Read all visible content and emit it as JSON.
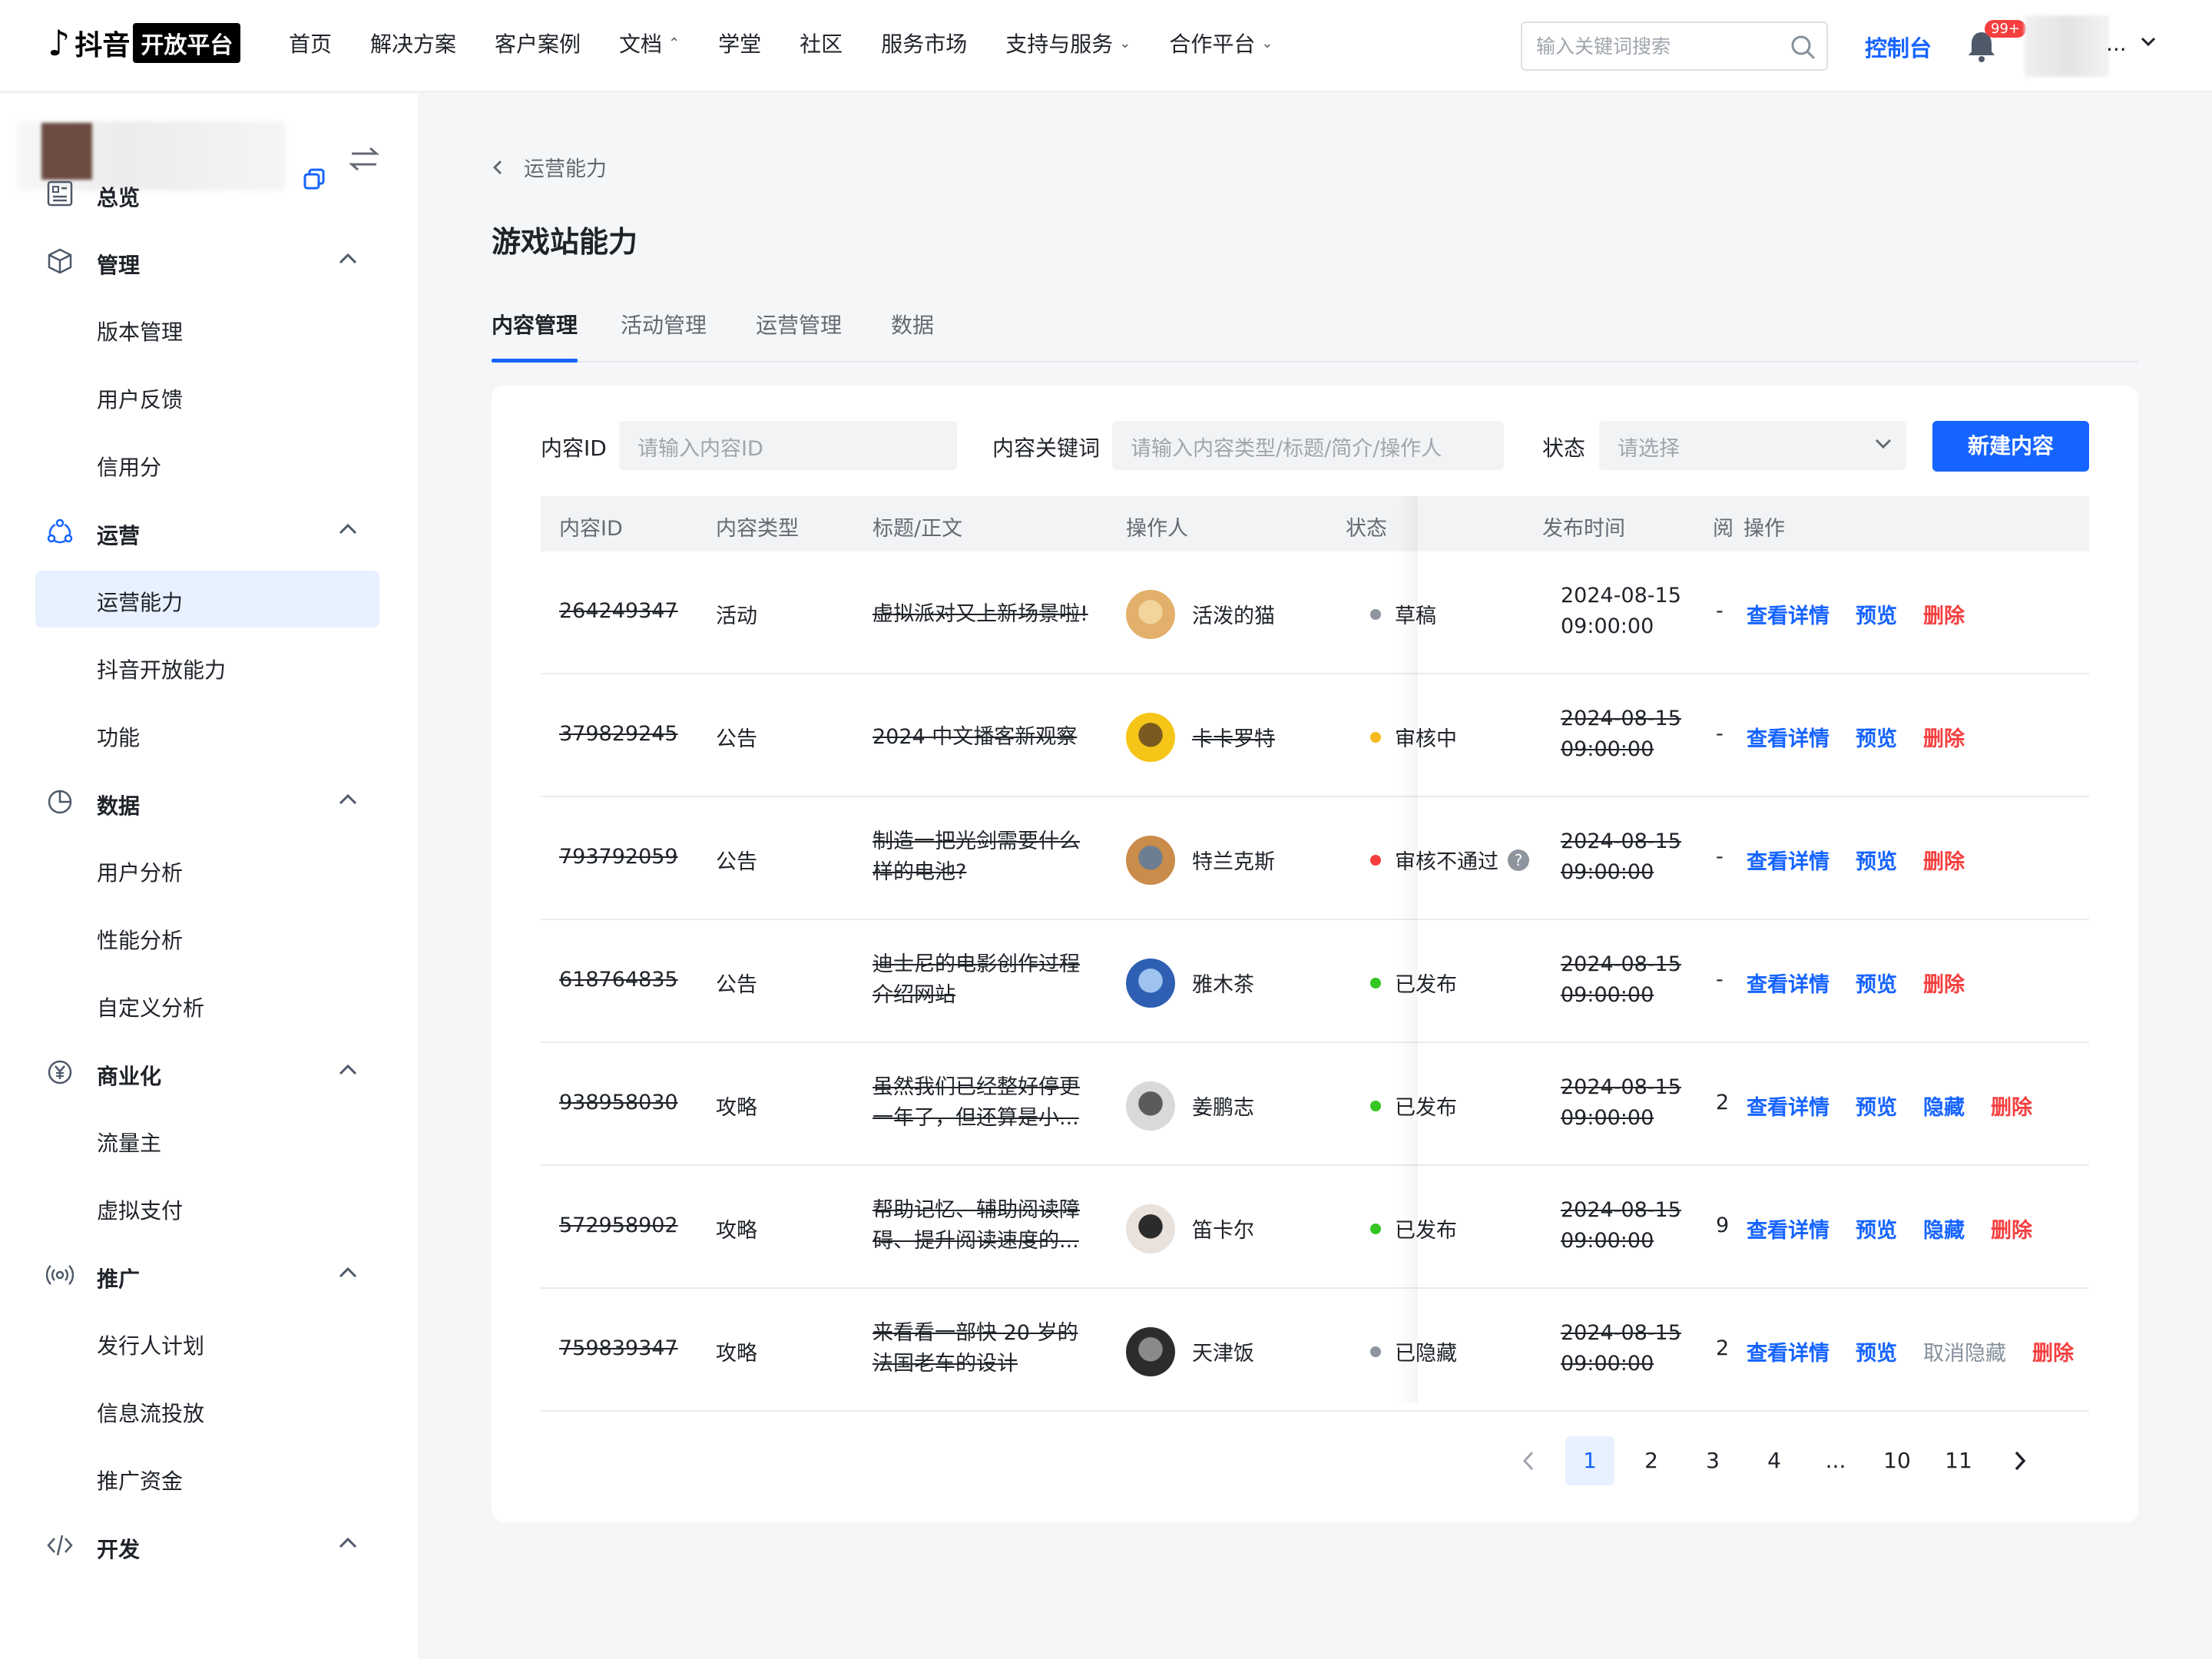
{
  "nav": {
    "logo_brand": "抖音",
    "logo_badge": "开放平台",
    "menu": [
      "首页",
      "解决方案",
      "客户案例",
      "文档",
      "学堂",
      "社区",
      "服务市场",
      "支持与服务",
      "合作平台"
    ],
    "menu_chev": [
      "",
      "",
      "",
      "⌃",
      "",
      "",
      "",
      "⌄",
      "⌄"
    ],
    "search_placeholder": "输入关键词搜索",
    "console": "控制台",
    "bell_count": "99+",
    "user_more": "..."
  },
  "sidebar": {
    "groups": [
      {
        "label": "总览",
        "icon": "overview-icon",
        "items": []
      },
      {
        "label": "管理",
        "icon": "cube-icon",
        "items": [
          "版本管理",
          "用户反馈",
          "信用分"
        ]
      },
      {
        "label": "运营",
        "icon": "operate-icon",
        "items": [
          "运营能力",
          "抖音开放能力",
          "功能"
        ]
      },
      {
        "label": "数据",
        "icon": "pie-icon",
        "items": [
          "用户分析",
          "性能分析",
          "自定义分析"
        ]
      },
      {
        "label": "商业化",
        "icon": "yuan-icon",
        "items": [
          "流量主",
          "虚拟支付"
        ]
      },
      {
        "label": "推广",
        "icon": "broadcast-icon",
        "items": [
          "发行人计划",
          "信息流投放",
          "推广资金"
        ]
      },
      {
        "label": "开发",
        "icon": "code-icon",
        "items": []
      }
    ],
    "active_item": "运营能力"
  },
  "main": {
    "breadcrumb": "运营能力",
    "title": "游戏站能力",
    "tabs": [
      "内容管理",
      "活动管理",
      "运营管理",
      "数据"
    ],
    "active_tab": "内容管理",
    "filters": {
      "id_label": "内容ID",
      "id_placeholder": "请输入内容ID",
      "kw_label": "内容关键词",
      "kw_placeholder": "请输入内容类型/标题/简介/操作人",
      "status_label": "状态",
      "status_placeholder": "请选择",
      "new_button": "新建内容"
    },
    "columns": [
      "内容ID",
      "内容类型",
      "标题/正文",
      "操作人",
      "状态",
      "发布时间",
      "阅",
      "操作"
    ],
    "rows": [
      {
        "id": "264249347",
        "type": "活动",
        "title": "虚拟派对又上新场景啦!",
        "operator": "活泼的猫",
        "status": "草稿",
        "status_color": "#8f959e",
        "time1": "2024-08-15",
        "time2": "09:00:00",
        "time_strike": false,
        "extra": "-",
        "ops": [
          "查看详情",
          "预览",
          "删除"
        ],
        "op_colors": [
          "blue",
          "blue",
          "red"
        ],
        "avatar": "cat-avatar"
      },
      {
        "id": "379829245",
        "type": "公告",
        "title": "2024 中文播客新观察",
        "operator": "卡卡罗特",
        "status": "审核中",
        "status_color": "#f7ba1e",
        "time1": "2024-08-15",
        "time2": "09:00:00",
        "time_strike": true,
        "extra": "-",
        "ops": [
          "查看详情",
          "预览",
          "删除"
        ],
        "op_colors": [
          "blue",
          "blue",
          "red"
        ],
        "avatar": "duck-avatar"
      },
      {
        "id": "793792059",
        "type": "公告",
        "title": "制造一把光剑需要什么样的电池?",
        "operator": "特兰克斯",
        "status": "审核不通过",
        "status_color": "#f53f3f",
        "time1": "2024-08-15",
        "time2": "09:00:00",
        "time_strike": true,
        "extra": "-",
        "ops": [
          "查看详情",
          "预览",
          "删除"
        ],
        "op_colors": [
          "blue",
          "blue",
          "red"
        ],
        "avatar": "dog-avatar"
      },
      {
        "id": "618764835",
        "type": "公告",
        "title": "迪士尼的电影创作过程介绍网站",
        "operator": "雅木茶",
        "status": "已发布",
        "status_color": "#34c724",
        "time1": "2024-08-15",
        "time2": "09:00:00",
        "time_strike": true,
        "extra": "-",
        "ops": [
          "查看详情",
          "预览",
          "删除"
        ],
        "op_colors": [
          "blue",
          "blue",
          "red"
        ],
        "avatar": "sky-avatar"
      },
      {
        "id": "938958030",
        "type": "攻略",
        "title": "虽然我们已经整好停更一年了，但还算是小...",
        "operator": "姜鹏志",
        "status": "已发布",
        "status_color": "#34c724",
        "time1": "2024-08-15",
        "time2": "09:00:00",
        "time_strike": true,
        "extra": "2",
        "ops": [
          "查看详情",
          "预览",
          "隐藏",
          "删除"
        ],
        "op_colors": [
          "blue",
          "blue",
          "blue",
          "red"
        ],
        "avatar": "kitten-avatar"
      },
      {
        "id": "572958902",
        "type": "攻略",
        "title": "帮助记忆、辅助阅读障碍、提升阅读速度的...",
        "operator": "笛卡尔",
        "status": "已发布",
        "status_color": "#34c724",
        "time1": "2024-08-15",
        "time2": "09:00:00",
        "time_strike": true,
        "extra": "9",
        "ops": [
          "查看详情",
          "预览",
          "隐藏",
          "删除"
        ],
        "op_colors": [
          "blue",
          "blue",
          "blue",
          "red"
        ],
        "avatar": "girl-avatar"
      },
      {
        "id": "759839347",
        "type": "攻略",
        "title": "来看看一部快 20 岁的法国老车的设计",
        "operator": "天津饭",
        "status": "已隐藏",
        "status_color": "#8f959e",
        "time1": "2024-08-15",
        "time2": "09:00:00",
        "time_strike": true,
        "extra": "2",
        "ops": [
          "查看详情",
          "预览",
          "取消隐藏",
          "删除"
        ],
        "op_colors": [
          "blue",
          "blue",
          "gray",
          "red"
        ],
        "avatar": "dark-avatar"
      }
    ],
    "pagination": {
      "pages": [
        "1",
        "2",
        "3",
        "4",
        "...",
        "10",
        "11"
      ],
      "current": "1"
    }
  }
}
